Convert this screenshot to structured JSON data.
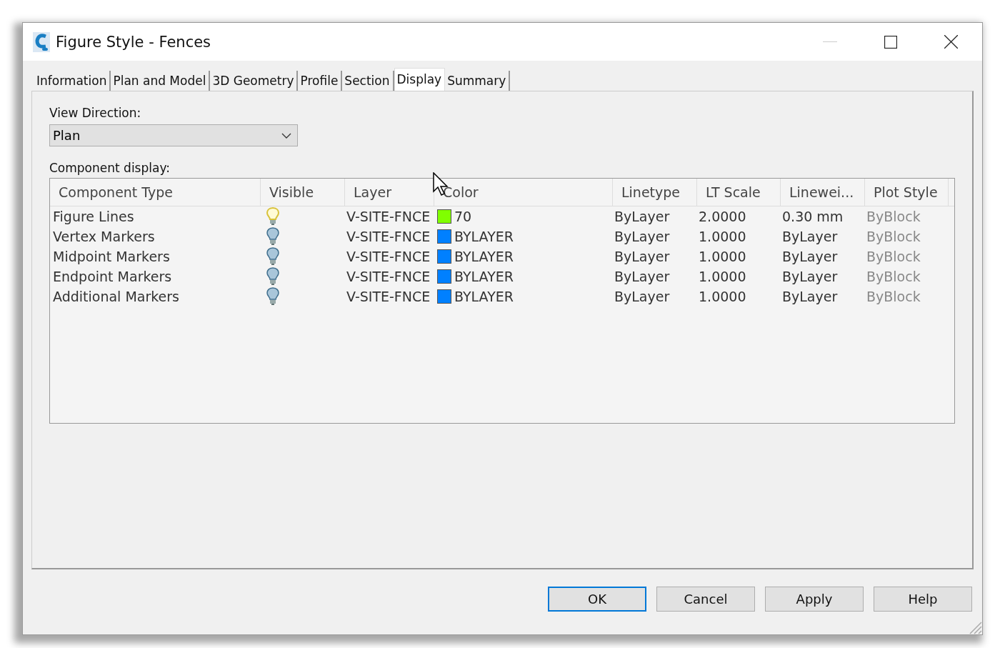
{
  "window": {
    "title": "Figure Style - Fences"
  },
  "tabs": [
    {
      "label": "Information",
      "selected": false
    },
    {
      "label": "Plan and Model",
      "selected": false
    },
    {
      "label": "3D Geometry",
      "selected": false
    },
    {
      "label": "Profile",
      "selected": false
    },
    {
      "label": "Section",
      "selected": false
    },
    {
      "label": "Display",
      "selected": true
    },
    {
      "label": "Summary",
      "selected": false
    }
  ],
  "view_direction": {
    "label": "View Direction:",
    "value": "Plan"
  },
  "component_display": {
    "label": "Component display:",
    "columns": [
      "Component Type",
      "Visible",
      "Layer",
      "Color",
      "Linetype",
      "LT Scale",
      "Linewei...",
      "Plot Style"
    ],
    "rows": [
      {
        "component_type": "Figure Lines",
        "visible": true,
        "layer": "V-SITE-FNCE",
        "color_label": "70",
        "color": "#80ff00",
        "linetype": "ByLayer",
        "lt_scale": "2.0000",
        "lineweight": "0.30 mm",
        "plot_style": "ByBlock",
        "plot_style_disabled": true
      },
      {
        "component_type": "Vertex Markers",
        "visible": false,
        "layer": "V-SITE-FNCE",
        "color_label": "BYLAYER",
        "color": "#0080ff",
        "linetype": "ByLayer",
        "lt_scale": "1.0000",
        "lineweight": "ByLayer",
        "plot_style": "ByBlock",
        "plot_style_disabled": true
      },
      {
        "component_type": "Midpoint Markers",
        "visible": false,
        "layer": "V-SITE-FNCE",
        "color_label": "BYLAYER",
        "color": "#0080ff",
        "linetype": "ByLayer",
        "lt_scale": "1.0000",
        "lineweight": "ByLayer",
        "plot_style": "ByBlock",
        "plot_style_disabled": true
      },
      {
        "component_type": "Endpoint Markers",
        "visible": false,
        "layer": "V-SITE-FNCE",
        "color_label": "BYLAYER",
        "color": "#0080ff",
        "linetype": "ByLayer",
        "lt_scale": "1.0000",
        "lineweight": "ByLayer",
        "plot_style": "ByBlock",
        "plot_style_disabled": true
      },
      {
        "component_type": "Additional Markers",
        "visible": false,
        "layer": "V-SITE-FNCE",
        "color_label": "BYLAYER",
        "color": "#0080ff",
        "linetype": "ByLayer",
        "lt_scale": "1.0000",
        "lineweight": "ByLayer",
        "plot_style": "ByBlock",
        "plot_style_disabled": true
      }
    ]
  },
  "buttons": [
    {
      "label": "OK",
      "default": true
    },
    {
      "label": "Cancel",
      "default": false
    },
    {
      "label": "Apply",
      "default": false
    },
    {
      "label": "Help",
      "default": false
    }
  ]
}
